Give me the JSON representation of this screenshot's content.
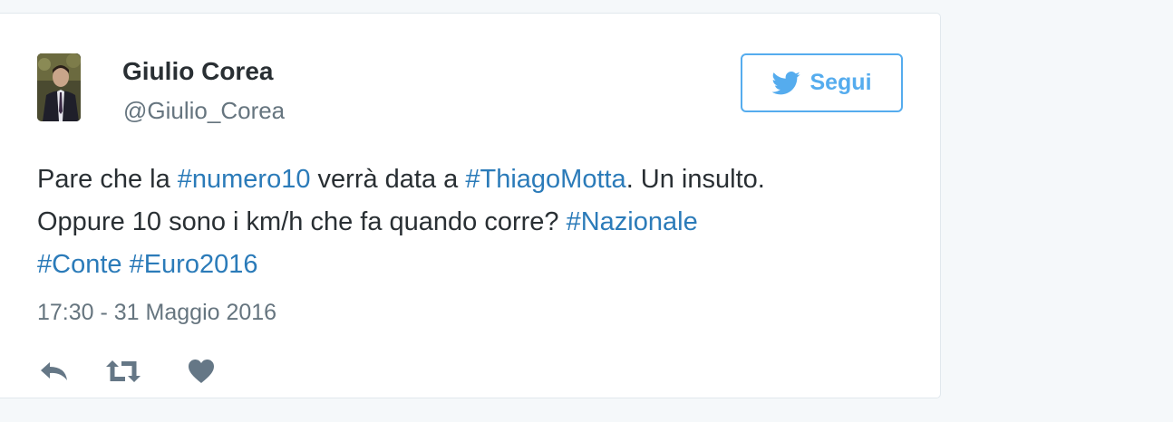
{
  "author": {
    "name": "Giulio Corea",
    "handle": "@Giulio_Corea"
  },
  "follow_button": {
    "label": "Segui",
    "icon": "twitter-bird-icon"
  },
  "tweet": {
    "line1": {
      "t1": "Pare che la ",
      "h1": "#numero10",
      "t2": " verrà data a ",
      "h2": "#ThiagoMotta",
      "t3": ". Un insulto."
    },
    "line2": {
      "t1": "Oppure 10 sono i km/h che fa quando corre? ",
      "h1": "#Nazionale"
    },
    "line3": {
      "h1": "#Conte",
      "t1": " ",
      "h2": "#Euro2016"
    },
    "timestamp": "17:30 - 31 Maggio 2016"
  },
  "actions": {
    "reply_icon": "reply-icon",
    "retweet_icon": "retweet-icon",
    "like_icon": "heart-icon"
  },
  "colors": {
    "link": "#2b7bb9",
    "accent": "#55acee",
    "text": "#292f33",
    "muted": "#66757f",
    "action_icon": "#657786"
  }
}
